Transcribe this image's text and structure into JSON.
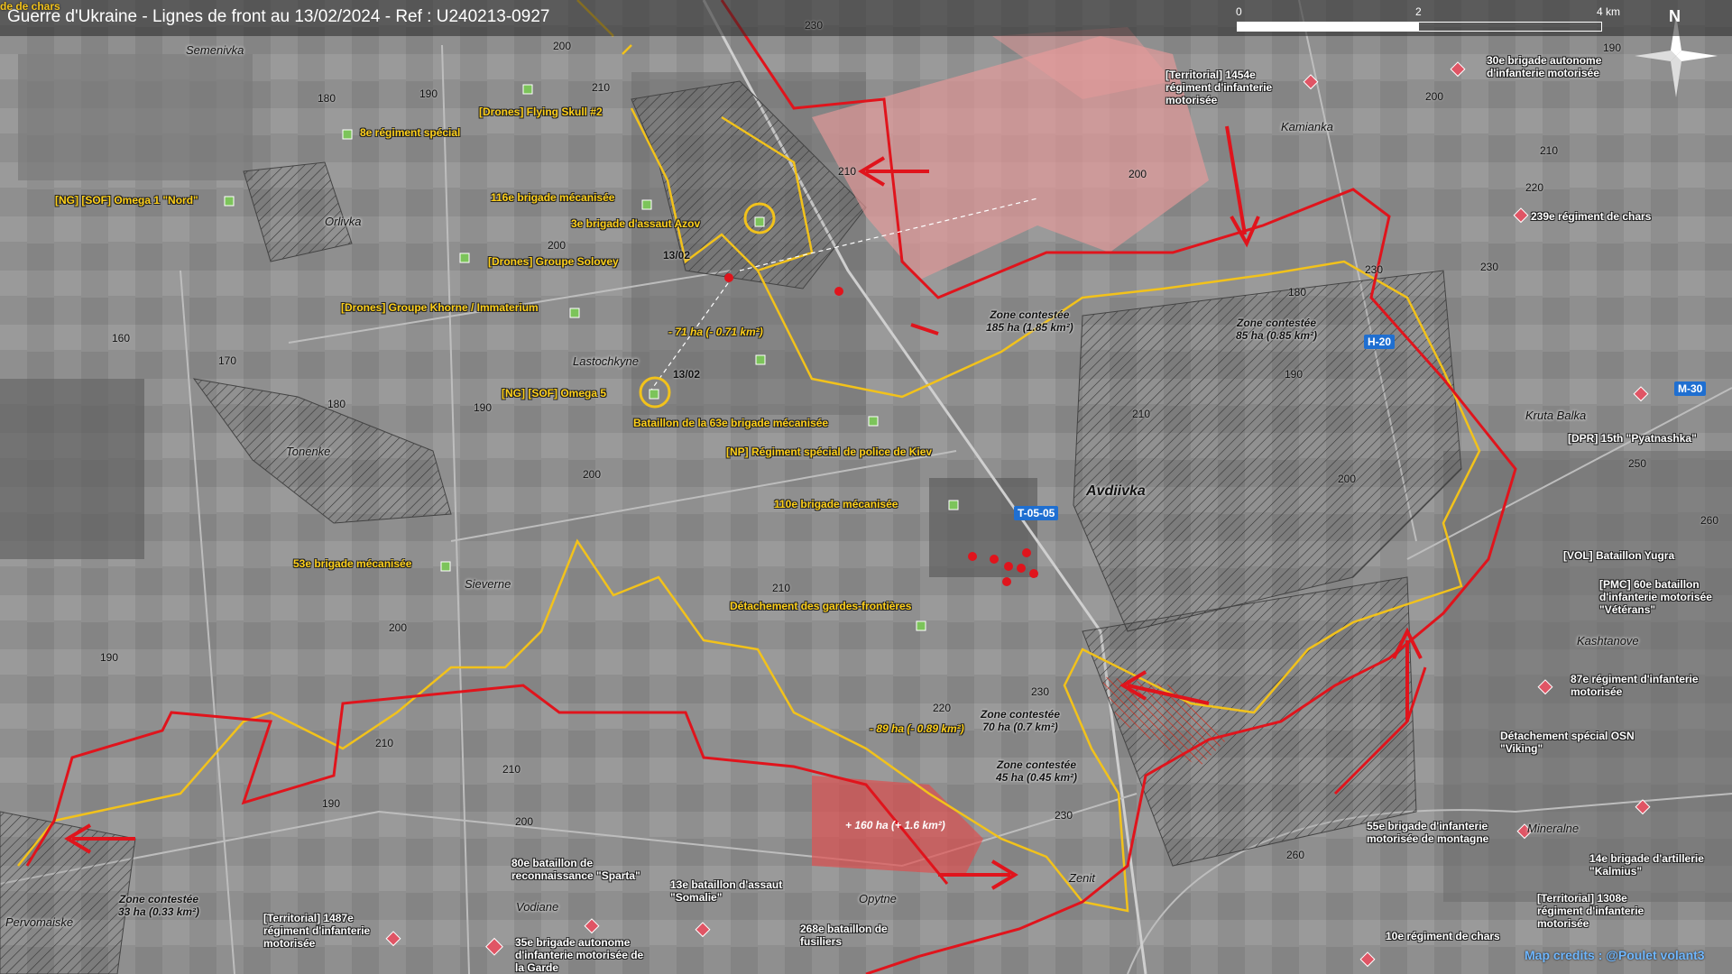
{
  "title": "Guerre d'Ukraine - Lignes de front au 13/02/2024 - Ref : U240213-0927",
  "corner_label": "de de chars",
  "scale": {
    "labels": [
      "0",
      "2",
      "4 km"
    ]
  },
  "compass": "N",
  "credits": "Map credits : @Poulet volant3",
  "colors": {
    "ua_units": "#ffd01a",
    "ru_units": "#e05565",
    "front_ru": "#e0141c",
    "front_ua": "#f2c21b",
    "gain": "#e24a4a"
  },
  "ua_units": [
    "[Drones] Flying Skull #2",
    "8e régiment spécial",
    "[NG] [SOF] Omega 1 \"Nord\"",
    "116e brigade mécanisée",
    "3e brigade d'assaut Azov",
    "[Drones] Groupe Solovey",
    "[Drones] Groupe Khorne / Immaterium",
    "[NG] [SOF] Omega 5",
    "Bataillon de la 63e brigade mécanisée",
    "[NP] Régiment spécial de police de Kiev",
    "110e brigade mécanisée",
    "53e brigade mécanisée",
    "Détachement des gardes-frontières"
  ],
  "ru_units": [
    "[Territorial] 1454e\nrégiment d'infanterie\nmotorisée",
    "30e brigade autonome\nd'infanterie motorisée",
    "239e régiment de chars",
    "[DPR] 15th \"Pyatnashka\"",
    "[VOL] Bataillon Yugra",
    "[PMC] 60e bataillon\nd'infanterie motorisée\n\"Vétérans\"",
    "87e régiment d'infanterie\nmotorisée",
    "Détachement spécial OSN\n\"Viking\"",
    "55e brigade d'infanterie\nmotorisée de montagne",
    "14e brigade d'artillerie\n\"Kalmius\"",
    "[Territorial] 1308e\nrégiment d'infanterie\nmotorisée",
    "10e régiment de chars",
    "80e bataillon de\nreconnaissance \"Sparta\"",
    "13e bataillon d'assaut\n\"Somalie\"",
    "268e bataillon de\nfusiliers",
    "[Territorial] 1487e\nrégiment d'infanterie\nmotorisée",
    "35e brigade autonome\nd'infanterie motorisée de\nla Garde"
  ],
  "towns": [
    "Semenivka",
    "Orlivka",
    "Lastochkyne",
    "Tonenke",
    "Sieverne",
    "Avdiivka",
    "Kamianka",
    "Kruta Balka",
    "Kashtanove",
    "Mineralne",
    "Zenit",
    "Opytne",
    "Vodiane",
    "Pervomaiske"
  ],
  "elevations": [
    "230",
    "200",
    "210",
    "180",
    "190",
    "200",
    "210",
    "160",
    "170",
    "180",
    "190",
    "200",
    "210",
    "200",
    "190",
    "210",
    "210",
    "200",
    "190",
    "220",
    "230",
    "230",
    "210",
    "260",
    "180",
    "200",
    "190",
    "230",
    "230",
    "200",
    "210",
    "220",
    "200",
    "250",
    "260",
    "190"
  ],
  "zones": [
    "Zone contestée\n185 ha (1.85 km²)",
    "Zone contestée\n85 ha (0.85 km²)",
    "Zone contestée\n70 ha (0.7 km²)",
    "Zone contestée\n45 ha (0.45 km²)",
    "Zone contestée\n33 ha (0.33 km²)"
  ],
  "changes": [
    "- 71 ha (- 0.71 km²)",
    "- 89 ha (- 0.89 km²)",
    "+ 160 ha (+ 1.6 km²)"
  ],
  "dates": [
    "13/02",
    "13/02"
  ],
  "roads": [
    "H-20",
    "M-30",
    "T-05-05"
  ]
}
